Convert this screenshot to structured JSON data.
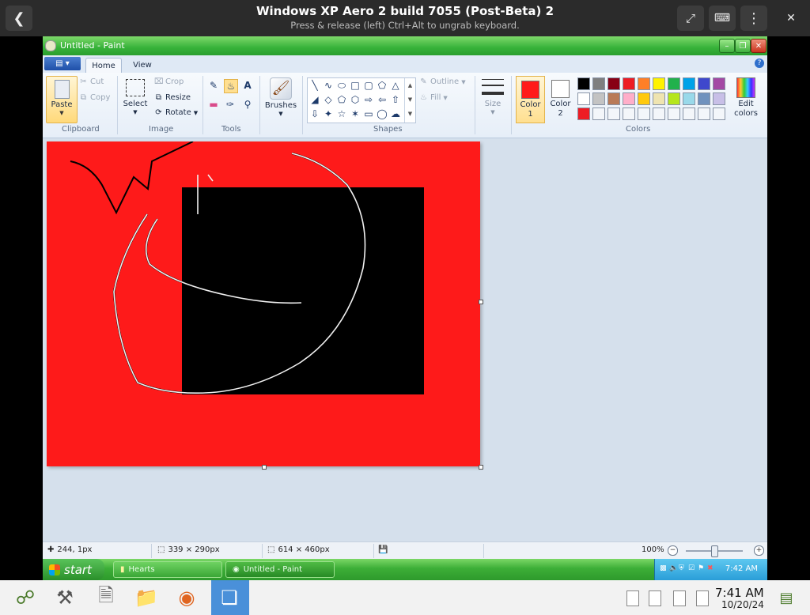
{
  "host": {
    "title": "Windows XP Aero 2 build 7055 (Post-Beta) 2",
    "subtitle": "Press & release (left) Ctrl+Alt to ungrab keyboard.",
    "back_icon": "chevron-left-icon",
    "fullscreen_icon": "fullscreen-icon",
    "keyboard_icon": "keyboard-icon",
    "menu_icon": "kebab-menu-icon",
    "close_icon": "close-icon",
    "clock": {
      "time": "7:41 AM",
      "date": "10/20/24"
    }
  },
  "window": {
    "title": "Untitled - Paint"
  },
  "ribbon": {
    "tabs": [
      {
        "label": "Home",
        "active": true
      },
      {
        "label": "View",
        "active": false
      }
    ],
    "clipboard": {
      "paste": "Paste",
      "cut": "Cut",
      "copy": "Copy",
      "label": "Clipboard"
    },
    "image": {
      "select": "Select",
      "crop": "Crop",
      "resize": "Resize",
      "rotate": "Rotate",
      "label": "Image"
    },
    "tools": {
      "label": "Tools"
    },
    "brushes": {
      "label": "Brushes"
    },
    "shapes": {
      "outline": "Outline",
      "fill": "Fill",
      "label": "Shapes"
    },
    "size": {
      "label": "Size"
    },
    "colors": {
      "color1_label": "Color 1",
      "color1_lines": [
        "Color",
        "1"
      ],
      "color1": "#ff1a1a",
      "color2_label": "Color 2",
      "color2_lines": [
        "Color",
        "2"
      ],
      "color2": "#ffffff",
      "edit": "Edit colors",
      "edit_lines": [
        "Edit",
        "colors"
      ],
      "label": "Colors",
      "palette_row1": [
        "#000000",
        "#7f7f7f",
        "#880015",
        "#ed1c24",
        "#ff7f27",
        "#fff200",
        "#22b14c",
        "#00a2e8",
        "#3f48cc",
        "#a349a4"
      ],
      "palette_row2": [
        "#ffffff",
        "#c3c3c3",
        "#b97a57",
        "#ffaec9",
        "#ffc90e",
        "#efe4b0",
        "#b5e61d",
        "#99d9ea",
        "#7092be",
        "#c8bfe7"
      ],
      "palette_row3": [
        "#ed1c24",
        "#f3f6fa",
        "#f3f6fa",
        "#f3f6fa",
        "#f3f6fa",
        "#f3f6fa",
        "#f3f6fa",
        "#f3f6fa",
        "#f3f6fa",
        "#f3f6fa"
      ]
    }
  },
  "canvas": {
    "background": "#fe1a1a",
    "shape_color": "#000000"
  },
  "status": {
    "cursor_pos": "244, 1px",
    "selection_size": "339 × 290px",
    "image_size": "614 × 460px",
    "zoom": "100%"
  },
  "taskbar": {
    "start": "start",
    "items": [
      {
        "label": "Hearts"
      },
      {
        "label": "Untitled - Paint"
      }
    ],
    "time": "7:42 AM"
  }
}
